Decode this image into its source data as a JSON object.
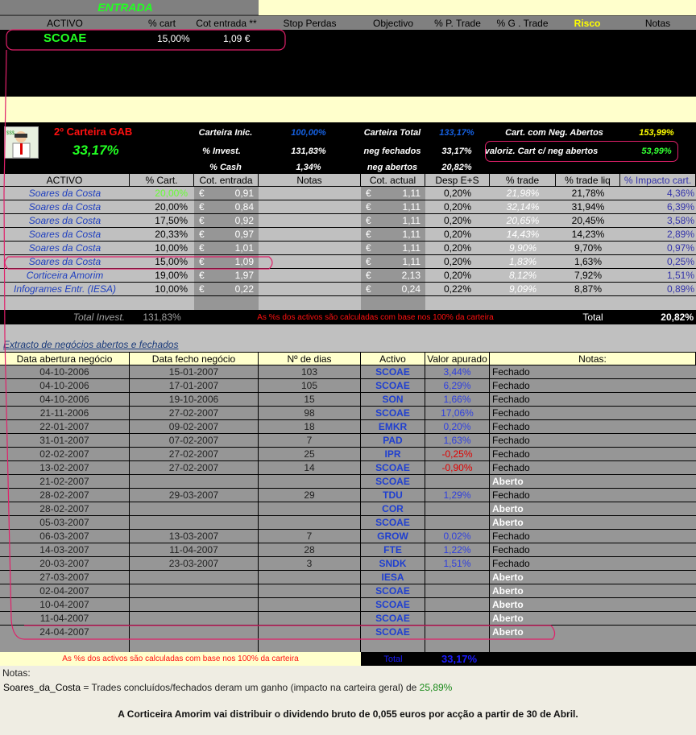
{
  "entrada": {
    "title": "ENTRADA",
    "headers": [
      "ACTIVO",
      "% cart",
      "Cot  entrada **",
      "Stop Perdas",
      "Objectivo",
      "% P. Trade",
      "% G . Trade",
      "Risco",
      "Notas"
    ],
    "row": {
      "activo": "SCOAE",
      "cart": "15,00%",
      "cot": "1,09 €"
    }
  },
  "portfolio": {
    "name": "2º Carteira GAB",
    "value": "33,17%",
    "avatar_icon": "cartoon-investor-icon",
    "stats": [
      {
        "label": "Carteira Inic.",
        "value": "100,00%",
        "color": "#1560e0"
      },
      {
        "label": "Carteira Total",
        "value": "133,17%",
        "color": "#1560e0"
      },
      {
        "label": "Cart. com Neg. Abertos",
        "value": "153,99%",
        "color": "#ffff00"
      },
      {
        "label": "% Invest.",
        "value": "131,83%",
        "color": "#ffffff"
      },
      {
        "label": "neg fechados",
        "value": "33,17%",
        "color": "#ffffff"
      },
      {
        "label": "valoriz. Cart c/ neg abertos",
        "value": "53,99%",
        "color": "#33ff33"
      },
      {
        "label": "%  Cash",
        "value": "1,34%",
        "color": "#ffffff"
      },
      {
        "label": "neg abertos",
        "value": "20,82%",
        "color": "#ffffff"
      }
    ]
  },
  "holdings": {
    "headers": [
      "ACTIVO",
      "% Cart.",
      "Cot. entrada",
      "Notas",
      "Cot. actual",
      "Desp E+S",
      "% trade",
      "% trade liq",
      "% Impacto cart."
    ],
    "currency": "€",
    "rows": [
      [
        "Soares da Costa",
        "20,00%",
        "0,91",
        "",
        "1,11",
        "0,20%",
        "21,98%",
        "21,78%",
        "4,36%"
      ],
      [
        "Soares da Costa",
        "20,00%",
        "0,84",
        "",
        "1,11",
        "0,20%",
        "32,14%",
        "31,94%",
        "6,39%"
      ],
      [
        "Soares da Costa",
        "17,50%",
        "0,92",
        "",
        "1,11",
        "0,20%",
        "20,65%",
        "20,45%",
        "3,58%"
      ],
      [
        "Soares da Costa",
        "20,33%",
        "0,97",
        "",
        "1,11",
        "0,20%",
        "14,43%",
        "14,23%",
        "2,89%"
      ],
      [
        "Soares da Costa",
        "10,00%",
        "1,01",
        "",
        "1,11",
        "0,20%",
        "9,90%",
        "9,70%",
        "0,97%"
      ],
      [
        "Soares da Costa",
        "15,00%",
        "1,09",
        "",
        "1,11",
        "0,20%",
        "1,83%",
        "1,63%",
        "0,25%"
      ],
      [
        "Corticeira Amorim",
        "19,00%",
        "1,97",
        "",
        "2,13",
        "0,20%",
        "8,12%",
        "7,92%",
        "1,51%"
      ],
      [
        "Infogrames Entr. (IESA)",
        "10,00%",
        "0,22",
        "",
        "0,24",
        "0,22%",
        "9,09%",
        "8,87%",
        "0,89%"
      ]
    ],
    "total_label": "Total Invest.",
    "total_value": "131,83%",
    "note": "As %s dos activos são calculadas com base nos 100% da carteira",
    "grand_total_label": "Total",
    "grand_total_value": "20,82%"
  },
  "extract": {
    "title": "Extracto de negócios abertos e fechados",
    "headers": [
      "Data abertura negócio",
      "Data fecho negócio",
      "Nº de dias",
      "Activo",
      "Valor apurado",
      "Notas:"
    ],
    "rows": [
      [
        "04-10-2006",
        "15-01-2007",
        "103",
        "SCOAE",
        "3,44%",
        "Fechado"
      ],
      [
        "04-10-2006",
        "17-01-2007",
        "105",
        "SCOAE",
        "6,29%",
        "Fechado"
      ],
      [
        "04-10-2006",
        "19-10-2006",
        "15",
        "SON",
        "1,66%",
        "Fechado"
      ],
      [
        "21-11-2006",
        "27-02-2007",
        "98",
        "SCOAE",
        "17,06%",
        "Fechado"
      ],
      [
        "22-01-2007",
        "09-02-2007",
        "18",
        "EMKR",
        "0,20%",
        "Fechado"
      ],
      [
        "31-01-2007",
        "07-02-2007",
        "7",
        "PAD",
        "1,63%",
        "Fechado"
      ],
      [
        "02-02-2007",
        "27-02-2007",
        "25",
        "IPR",
        "-0,25%",
        "Fechado"
      ],
      [
        "13-02-2007",
        "27-02-2007",
        "14",
        "SCOAE",
        "-0,90%",
        "Fechado"
      ],
      [
        "21-02-2007",
        "",
        "",
        "SCOAE",
        "",
        "Aberto"
      ],
      [
        "28-02-2007",
        "29-03-2007",
        "29",
        "TDU",
        "1,29%",
        "Fechado"
      ],
      [
        "28-02-2007",
        "",
        "",
        "COR",
        "",
        "Aberto"
      ],
      [
        "05-03-2007",
        "",
        "",
        "SCOAE",
        "",
        "Aberto"
      ],
      [
        "06-03-2007",
        "13-03-2007",
        "7",
        "GROW",
        "0,02%",
        "Fechado"
      ],
      [
        "14-03-2007",
        "11-04-2007",
        "28",
        "FTE",
        "1,22%",
        "Fechado"
      ],
      [
        "20-03-2007",
        "23-03-2007",
        "3",
        "SNDK",
        "1,51%",
        "Fechado"
      ],
      [
        "27-03-2007",
        "",
        "",
        "IESA",
        "",
        "Aberto"
      ],
      [
        "02-04-2007",
        "",
        "",
        "SCOAE",
        "",
        "Aberto"
      ],
      [
        "10-04-2007",
        "",
        "",
        "SCOAE",
        "",
        "Aberto"
      ],
      [
        "11-04-2007",
        "",
        "",
        "SCOAE",
        "",
        "Aberto"
      ],
      [
        "24-04-2007",
        "",
        "",
        "SCOAE",
        "",
        "Aberto"
      ]
    ],
    "note": "As %s dos activos são calculadas com base nos 100% da carteira",
    "total_label": "Total",
    "total_value": "33,17%"
  },
  "notes": {
    "title": "Notas:",
    "line1_name": "Soares_da_Costa",
    "line1_text": " = Trades concluídos/fechados deram um ganho (impacto na carteira geral) de ",
    "line1_value": "25,89%",
    "line2": "A Corticeira Amorim vai distribuir o dividendo bruto de 0,055 euros por acção a partir de 30 de Abril."
  },
  "colors": {
    "annotation": "#e0206a",
    "positive": "#2040d0",
    "negative": "#e00000",
    "green": "#33ff33"
  }
}
